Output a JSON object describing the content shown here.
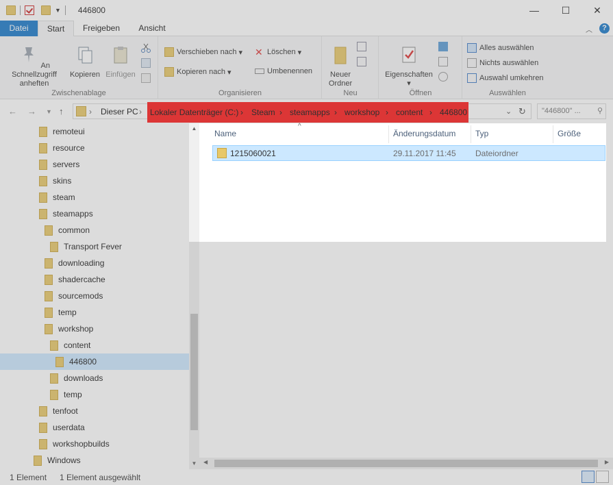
{
  "window": {
    "title": "446800",
    "minimize_glyph": "—",
    "maximize_glyph": "☐",
    "close_glyph": "✕"
  },
  "ribbon_tabs": [
    "Datei",
    "Start",
    "Freigeben",
    "Ansicht"
  ],
  "ribbon": {
    "zwischenablage": {
      "label": "Zwischenablage",
      "pin": "An Schnellzugriff anheften",
      "copy": "Kopieren",
      "paste": "Einfügen"
    },
    "organisieren": {
      "label": "Organisieren",
      "move": "Verschieben nach",
      "copy_to": "Kopieren nach",
      "delete": "Löschen",
      "rename": "Umbenennen"
    },
    "neu": {
      "label": "Neu",
      "new_folder": "Neuer Ordner"
    },
    "oeffnen": {
      "label": "Öffnen",
      "properties": "Eigenschaften"
    },
    "auswaehlen": {
      "label": "Auswählen",
      "select_all": "Alles auswählen",
      "select_none": "Nichts auswählen",
      "invert": "Auswahl umkehren"
    }
  },
  "address": {
    "root": "Dieser PC",
    "crumbs": [
      "Lokaler Datenträger (C:)",
      "Steam",
      "steamapps",
      "workshop",
      "content",
      "446800"
    ],
    "search_placeholder": "\"446800\" ...",
    "highlight_color": "#ff1a1a"
  },
  "tree": [
    {
      "label": "remoteui",
      "indent": 0
    },
    {
      "label": "resource",
      "indent": 0
    },
    {
      "label": "servers",
      "indent": 0
    },
    {
      "label": "skins",
      "indent": 0
    },
    {
      "label": "steam",
      "indent": 0
    },
    {
      "label": "steamapps",
      "indent": 0
    },
    {
      "label": "common",
      "indent": 1
    },
    {
      "label": "Transport Fever",
      "indent": 2
    },
    {
      "label": "downloading",
      "indent": 1
    },
    {
      "label": "shadercache",
      "indent": 1
    },
    {
      "label": "sourcemods",
      "indent": 1
    },
    {
      "label": "temp",
      "indent": 1
    },
    {
      "label": "workshop",
      "indent": 1
    },
    {
      "label": "content",
      "indent": 2
    },
    {
      "label": "446800",
      "indent": 3,
      "selected": true
    },
    {
      "label": "downloads",
      "indent": 2
    },
    {
      "label": "temp",
      "indent": 2
    },
    {
      "label": "tenfoot",
      "indent": 0
    },
    {
      "label": "userdata",
      "indent": 0
    },
    {
      "label": "workshopbuilds",
      "indent": 0
    },
    {
      "label": "Windows",
      "indent": -1
    }
  ],
  "columns": {
    "name": "Name",
    "date": "Änderungsdatum",
    "type": "Typ",
    "size": "Größe"
  },
  "files": [
    {
      "name": "1215060021",
      "date": "29.11.2017 11:45",
      "type": "Dateiordner",
      "size": ""
    }
  ],
  "status": {
    "count": "1 Element",
    "selected": "1 Element ausgewählt"
  },
  "colors": {
    "accent": "#1979ca",
    "selection": "#cce8ff",
    "folder": "#e8c868"
  }
}
